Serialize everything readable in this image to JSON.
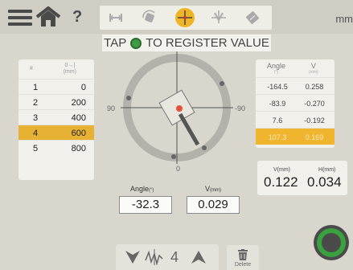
{
  "topbar": {
    "unit": "mm",
    "help": "?"
  },
  "banner": {
    "text_before": "TAP",
    "text_after": "TO REGISTER VALUE"
  },
  "left_table": {
    "col_index": "#",
    "col_value_icon": "0→|",
    "col_value_unit": "(mm)",
    "rows": [
      {
        "index": "1",
        "value": "0"
      },
      {
        "index": "2",
        "value": "200"
      },
      {
        "index": "3",
        "value": "400"
      },
      {
        "index": "4",
        "value": "600"
      },
      {
        "index": "5",
        "value": "800"
      }
    ],
    "selected_index": 3
  },
  "dial": {
    "left": "90",
    "right": "-90",
    "bottom": "0"
  },
  "fields": {
    "angle_label": "Angle",
    "angle_unit": "(°)",
    "angle_value": "-32.3",
    "v_label": "V",
    "v_unit": "(mm)",
    "v_value": "0.029"
  },
  "right_table": {
    "col_angle": "Angle",
    "col_angle_unit": "(°)",
    "col_v": "V",
    "col_v_unit": "(mm)",
    "rows": [
      {
        "angle": "-164.5",
        "v": "0.258"
      },
      {
        "angle": "-83.9",
        "v": "-0.270"
      },
      {
        "angle": "7.6",
        "v": "-0.192"
      },
      {
        "angle": "107.3",
        "v": "0.169"
      }
    ],
    "selected_index": 3
  },
  "vh": {
    "v_label": "V",
    "v_unit": "(mm)",
    "v_value": "0.122",
    "h_label": "H",
    "h_unit": "(mm)",
    "h_value": "0.034"
  },
  "stepper": {
    "value": "4"
  },
  "delete": {
    "label": "Delete"
  },
  "colors": {
    "accent": "#f0b427",
    "register_green": "#3f9b45",
    "background": "#d8d6cd"
  },
  "icons": {
    "menu": "hamburger-icon",
    "home": "home-icon",
    "help": "help-icon",
    "modes": [
      "horizontal-measure-icon",
      "rotate-icon",
      "crosshair-icon",
      "level-icon",
      "tag-icon"
    ],
    "register": "register-button-icon",
    "delete": "trash-icon"
  }
}
